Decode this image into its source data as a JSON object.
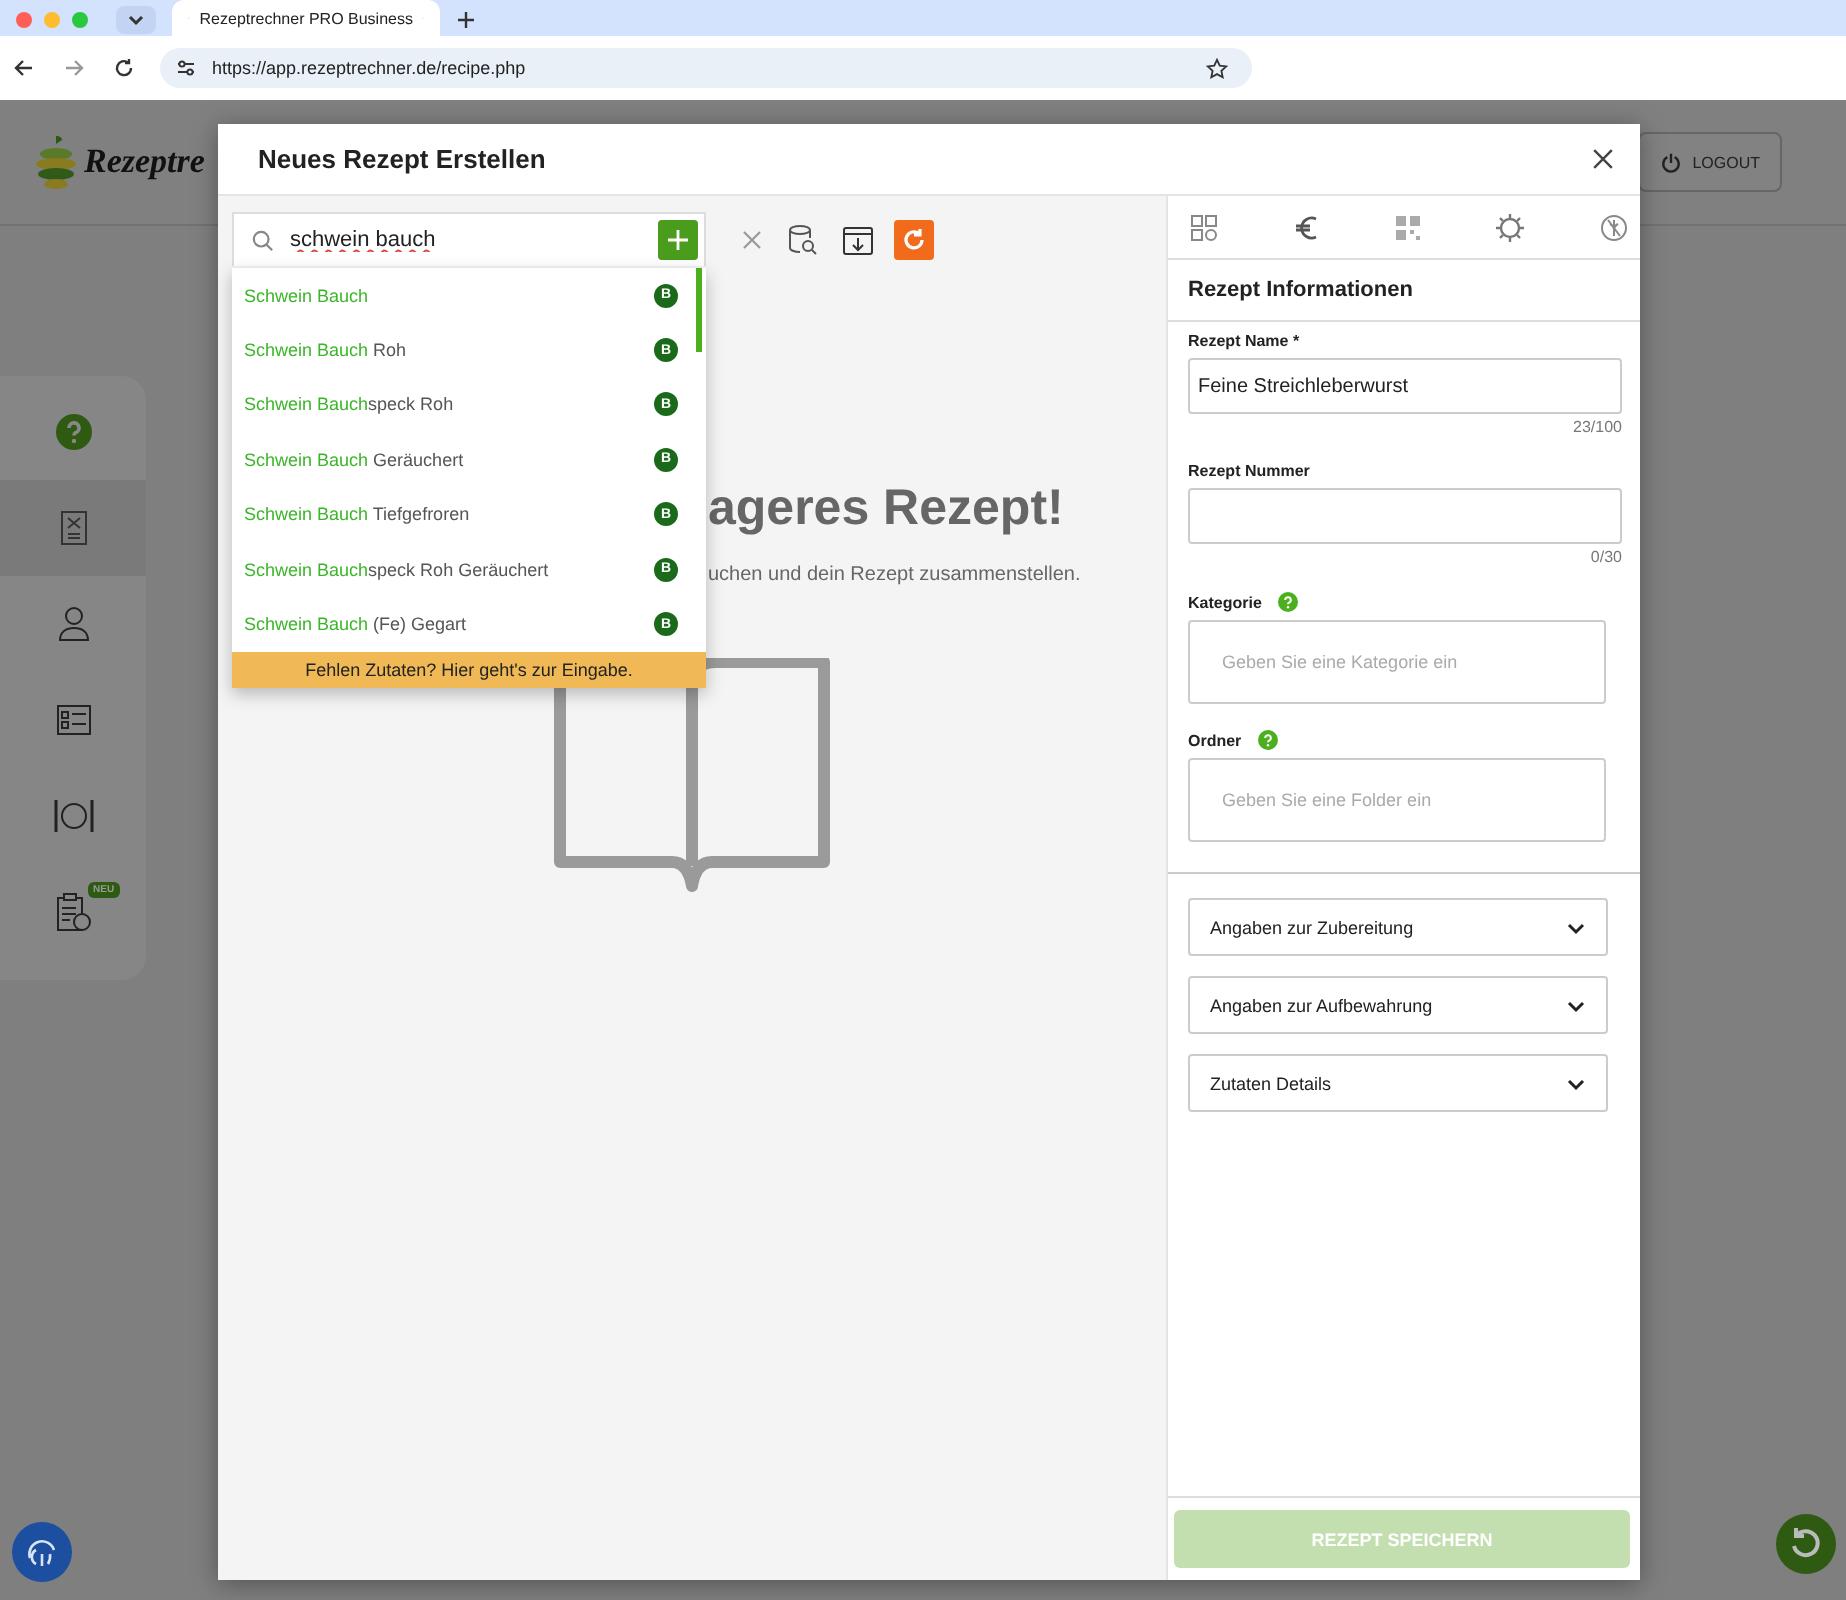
{
  "browser": {
    "tab_title": "Rezeptrechner PRO Business",
    "url": "https://app.rezeptrechner.de/recipe.php"
  },
  "app": {
    "logo_text": "Rezeptre",
    "logout": "LOGOUT",
    "sidebar": [
      {
        "kind": "help",
        "selected": false
      },
      {
        "kind": "recipe",
        "selected": true
      },
      {
        "kind": "user",
        "selected": false
      },
      {
        "kind": "checklist",
        "selected": false
      },
      {
        "kind": "dining",
        "selected": false
      },
      {
        "kind": "clipboard",
        "selected": false,
        "badge": "NEU"
      }
    ]
  },
  "modal": {
    "title": "Neues Rezept Erstellen",
    "search": {
      "value": "schwein bauch"
    },
    "suggestions": [
      {
        "match": "Schwein Bauch",
        "badge": "B"
      },
      {
        "match": "Schwein Bauch",
        "rest": " Roh",
        "badge": "B"
      },
      {
        "match": "Schwein Bauch",
        "rest": "speck Roh",
        "badge": "B"
      },
      {
        "match": "Schwein Bauch",
        "rest": " Geräuchert",
        "badge": "B"
      },
      {
        "match": "Schwein Bauch",
        "rest": " Tiefgefroren",
        "badge": "B"
      },
      {
        "match": "Schwein Bauch",
        "rest": "speck Roh Geräuchert",
        "badge": "B"
      },
      {
        "match": "Schwein Bauch",
        "rest": " (Fe) Gegart",
        "badge": "B"
      }
    ],
    "missing_hint": "Fehlen Zutaten? Hier geht's zur Eingabe.",
    "empty_state": {
      "heading": "ageres Rezept!",
      "text": "uchen und dein Rezept zusammenstellen."
    },
    "panel": {
      "heading": "Rezept Informationen",
      "fields": [
        {
          "kind": "text",
          "label": "Rezept Name *",
          "value": "Feine Streichleberwurst",
          "counter": "23/100"
        },
        {
          "kind": "text",
          "label": "Rezept Nummer",
          "counter": "0/30"
        },
        {
          "kind": "tags",
          "label": "Kategorie",
          "help": true,
          "placeholder": "Geben Sie eine Kategorie ein"
        },
        {
          "kind": "tags",
          "label": "Ordner",
          "help": true,
          "placeholder": "Geben Sie eine Folder ein"
        }
      ],
      "sections": [
        {
          "label": "Angaben zur Zubereitung",
          "expanded": false
        },
        {
          "label": "Angaben zur Aufbewahrung",
          "expanded": false
        },
        {
          "label": "Zutaten Details",
          "expanded": false
        }
      ],
      "save": {
        "label": "REZEPT SPEICHERN",
        "disabled": true
      }
    }
  }
}
